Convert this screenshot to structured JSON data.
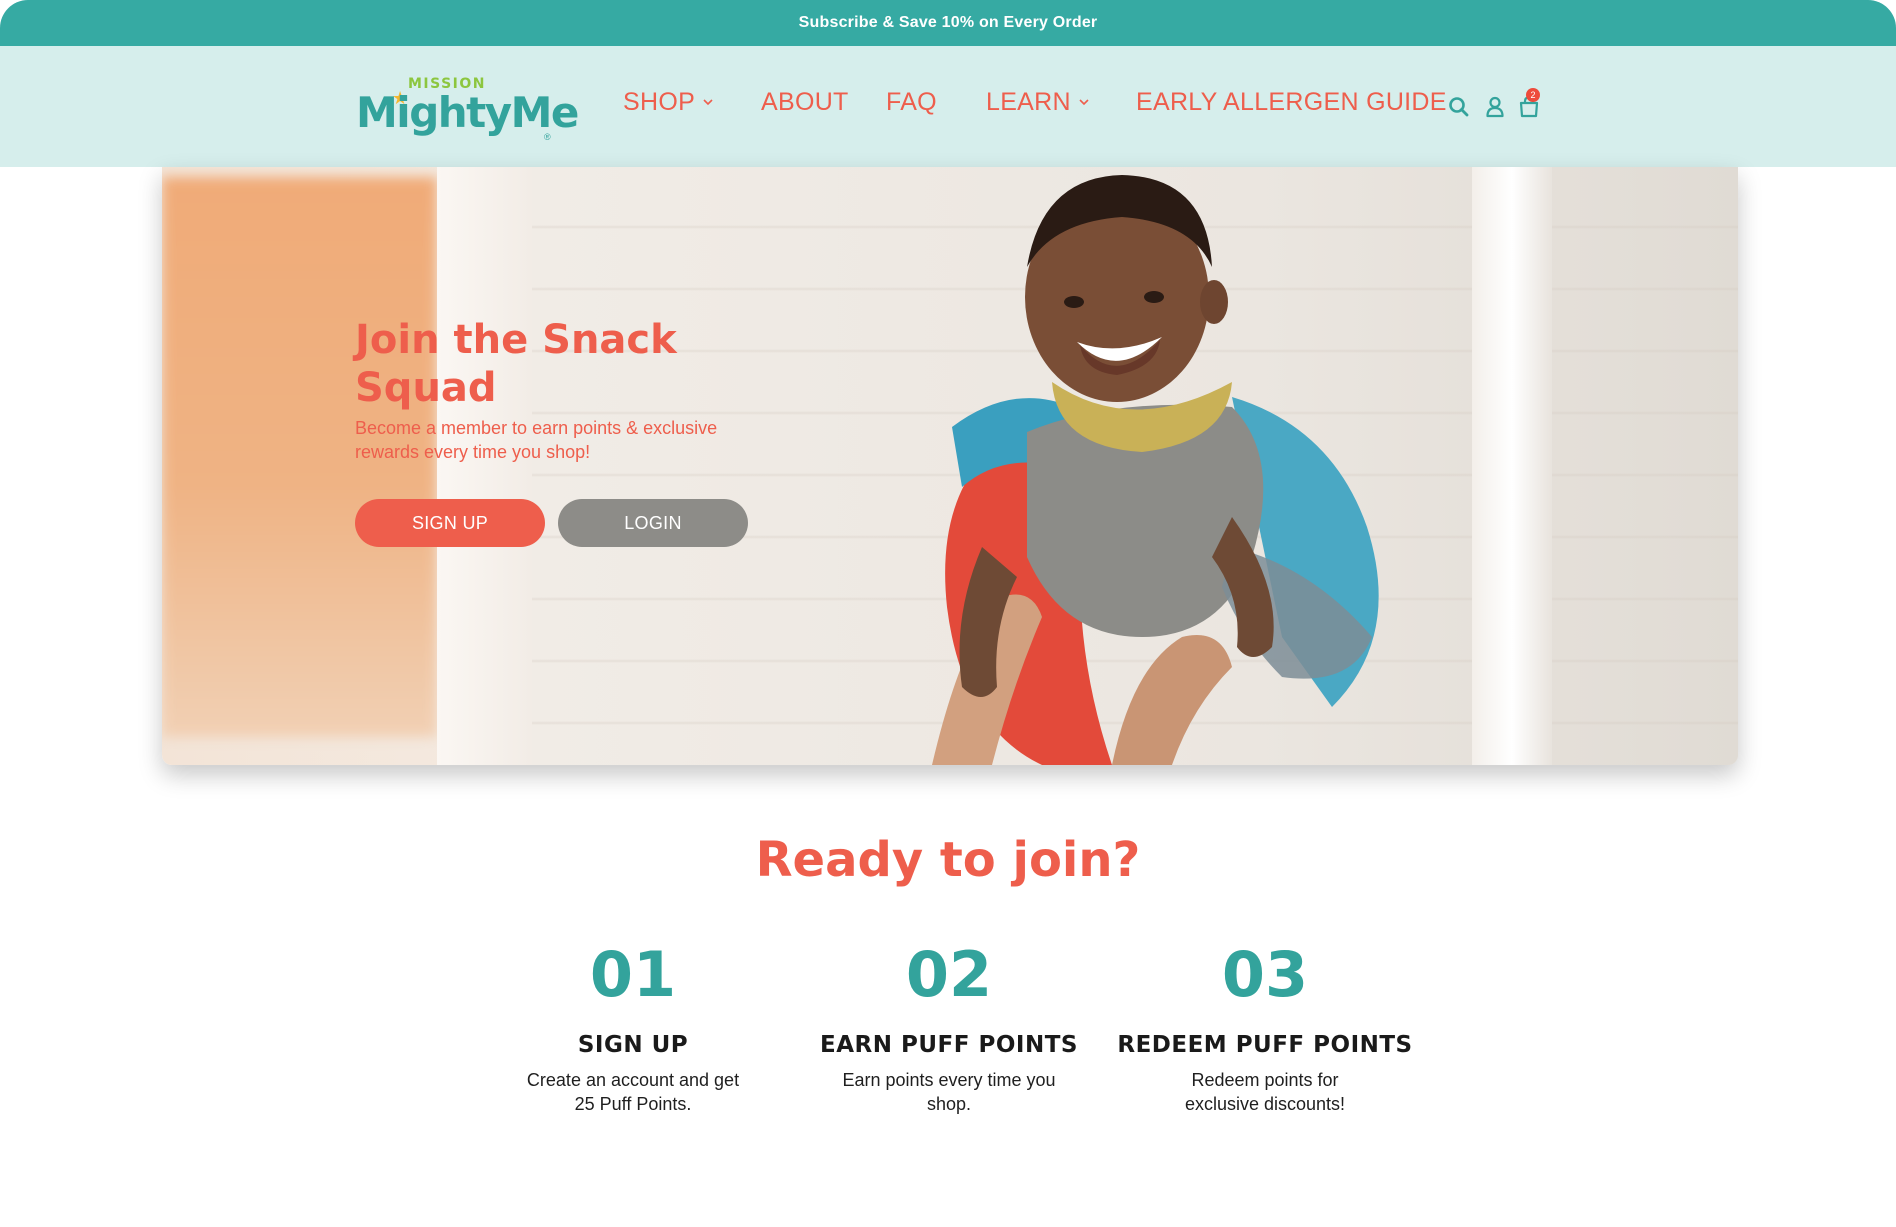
{
  "announcement": "Subscribe & Save 10% on Every Order",
  "logo": {
    "small": "MISSION",
    "main": "MightyMe",
    "mark": "®"
  },
  "nav": {
    "items": [
      {
        "label": "SHOP",
        "dropdown": true
      },
      {
        "label": "ABOUT",
        "dropdown": false
      },
      {
        "label": "FAQ",
        "dropdown": false
      },
      {
        "label": "LEARN",
        "dropdown": true
      },
      {
        "label": "EARLY ALLERGEN GUIDE",
        "dropdown": false
      }
    ],
    "icons": [
      "search-icon",
      "user-icon",
      "cart-icon"
    ],
    "cart_count": "2"
  },
  "hero": {
    "title": "Join the Snack Squad",
    "subtitle": "Become a member to earn points & exclusive rewards every time you shop!",
    "signup_label": "SIGN UP",
    "login_label": "LOGIN"
  },
  "ready": {
    "title": "Ready to join?",
    "steps": [
      {
        "num": "01",
        "label": "SIGN UP",
        "desc": "Create an account and get 25 Puff Points."
      },
      {
        "num": "02",
        "label": "EARN PUFF POINTS",
        "desc": "Earn points every time you shop."
      },
      {
        "num": "03",
        "label": "REDEEM PUFF POINTS",
        "desc": "Redeem points for exclusive discounts!"
      }
    ]
  },
  "colors": {
    "teal": "#36aaa3",
    "header_bg": "#d6eeec",
    "coral": "#ee5e4c",
    "gray_button": "#8d8c88",
    "logo_green": "#8cc63f"
  }
}
